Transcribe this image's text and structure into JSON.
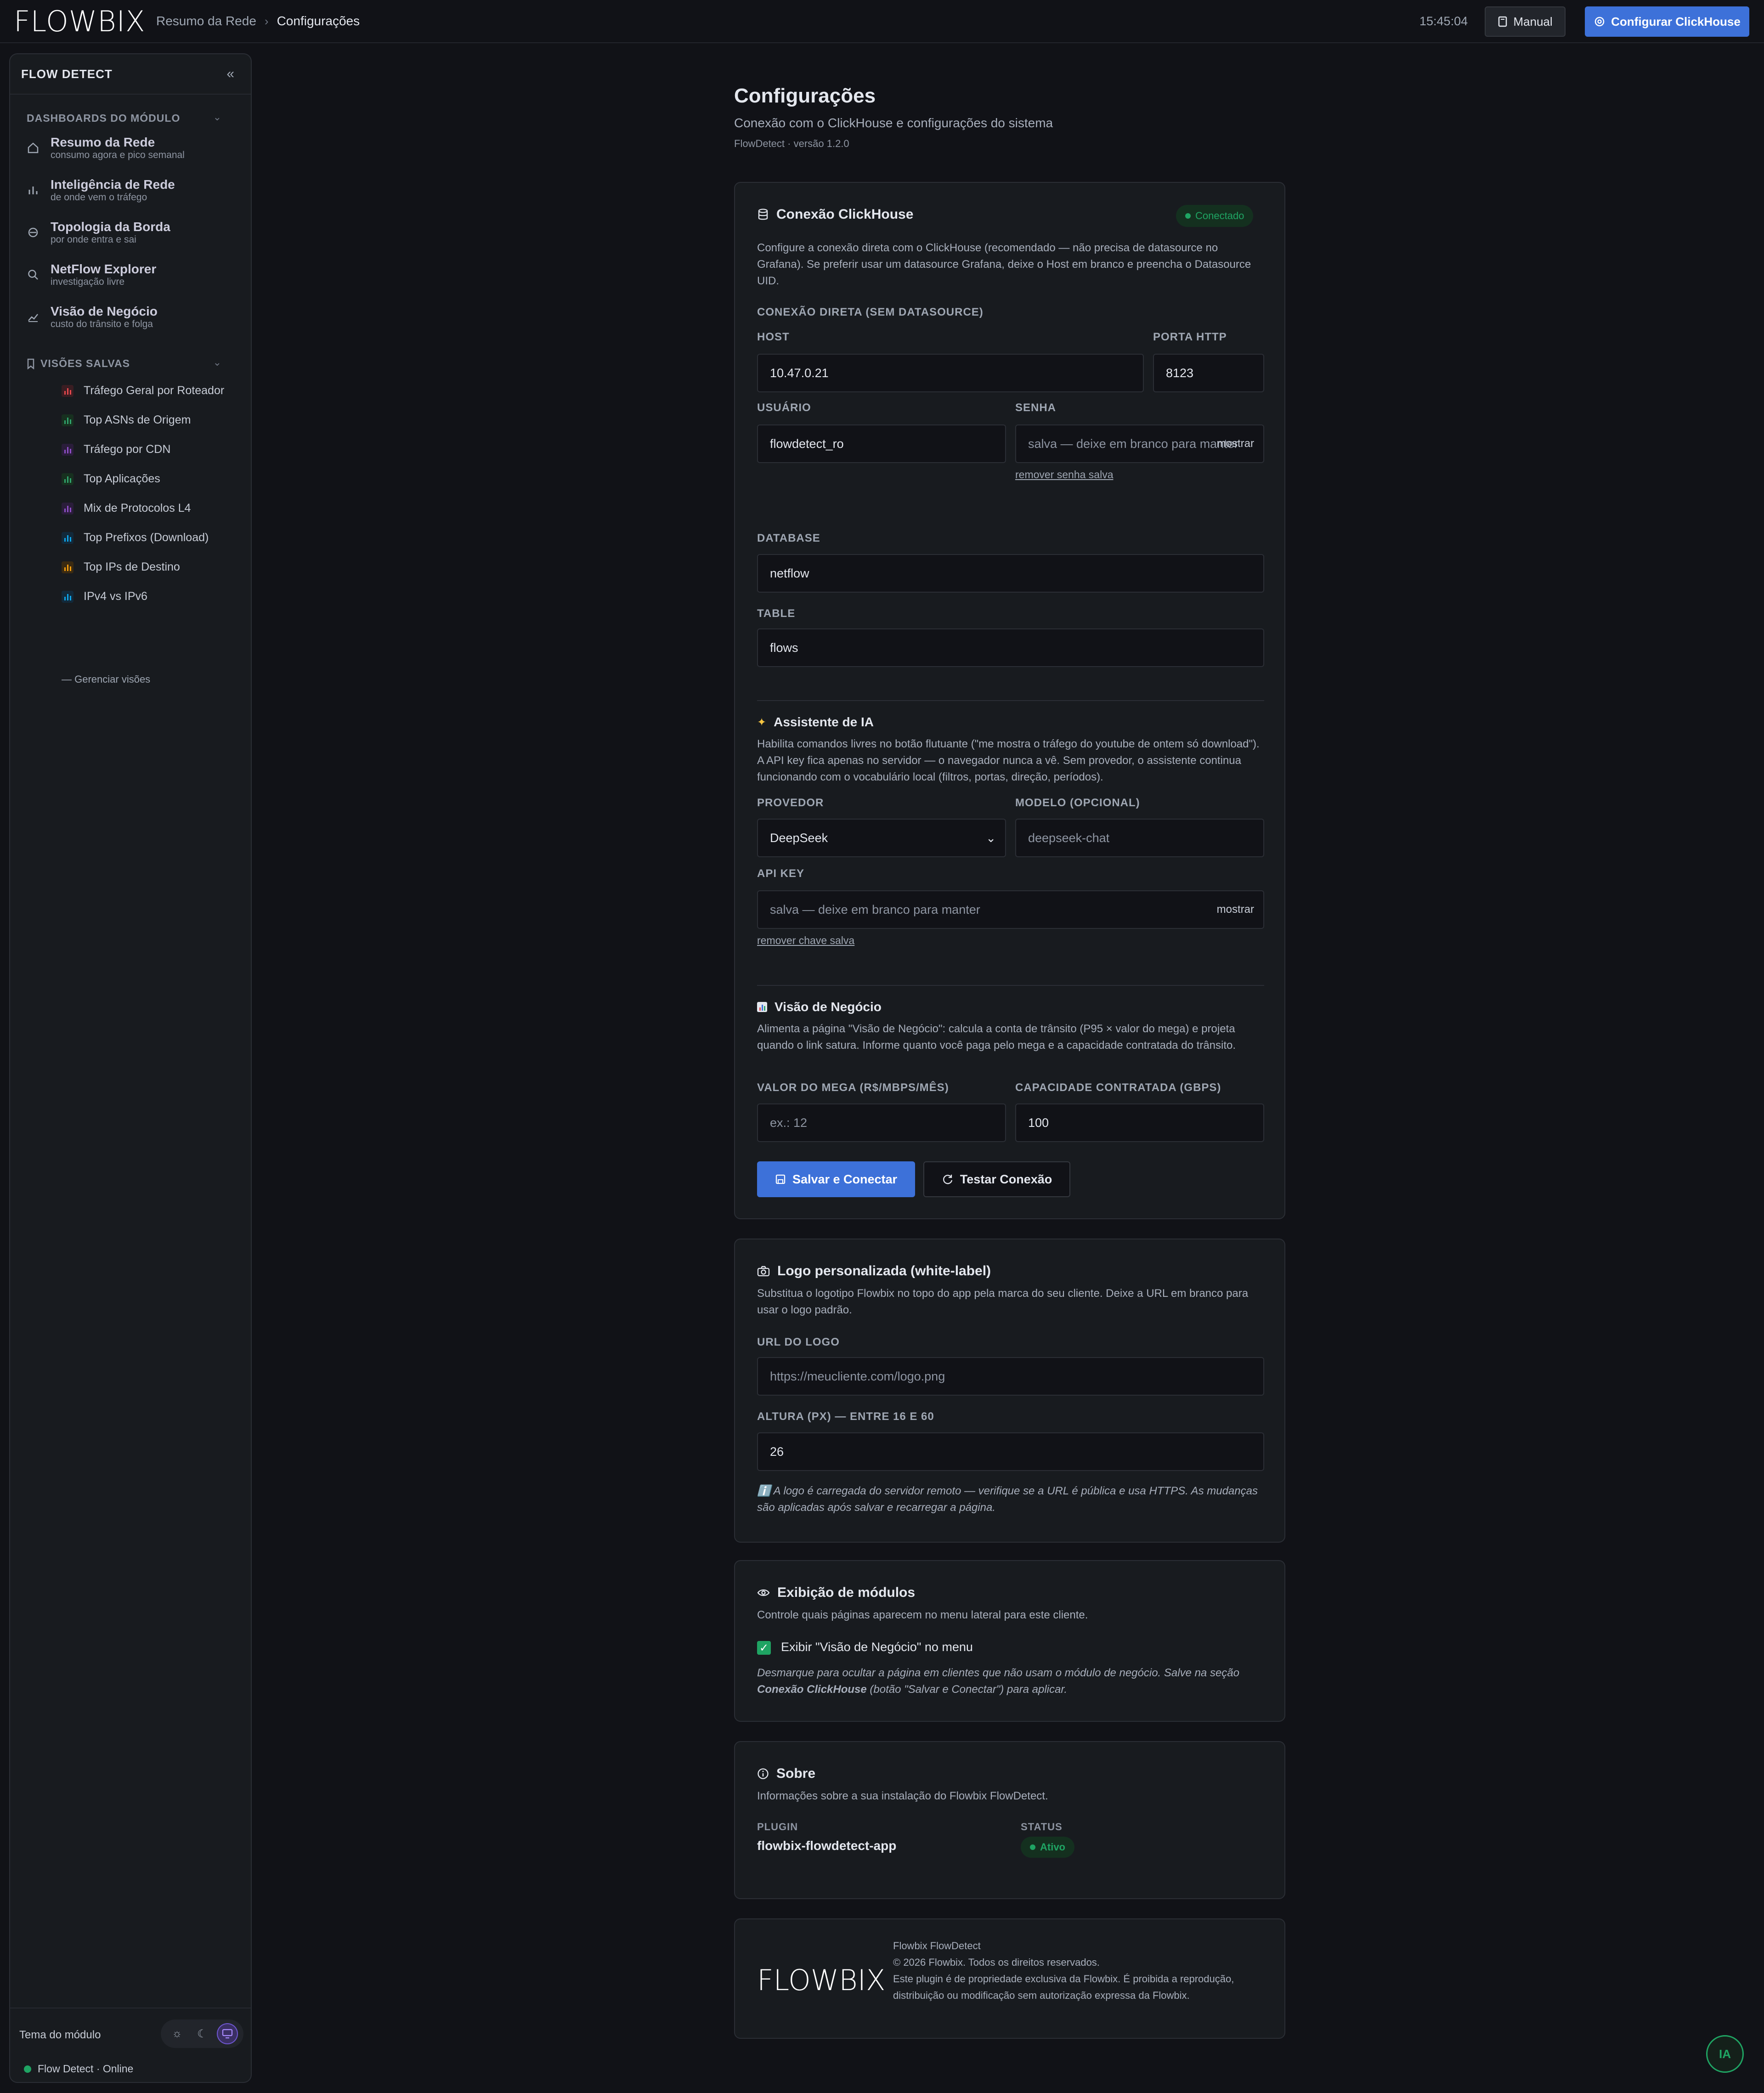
{
  "brand": {
    "logo_text": "FLOWBIX"
  },
  "topbar": {
    "breadcrumb_parent": "Resumo da Rede",
    "breadcrumb_sep": "›",
    "breadcrumb_current": "Configurações",
    "clock": "15:45:04",
    "manual_label": "Manual",
    "config_label": "Configurar ClickHouse"
  },
  "sidebar": {
    "title": "FLOW DETECT",
    "collapse_icon": "«",
    "section_dashboards": "DASHBOARDS DO MÓDULO",
    "nav": [
      {
        "title": "Resumo da Rede",
        "sub": "consumo agora e pico semanal",
        "icon": "home-icon"
      },
      {
        "title": "Inteligência de Rede",
        "sub": "de onde vem o tráfego",
        "icon": "bar-chart-icon"
      },
      {
        "title": "Topologia da Borda",
        "sub": "por onde entra e sai",
        "icon": "topology-icon"
      },
      {
        "title": "NetFlow Explorer",
        "sub": "investigação livre",
        "icon": "search-icon"
      },
      {
        "title": "Visão de Negócio",
        "sub": "custo do trânsito e folga",
        "icon": "trend-icon"
      }
    ],
    "section_saved": "VISÕES SALVAS",
    "saved": [
      {
        "label": "Tráfego Geral por Roteador",
        "color": "#e5484d"
      },
      {
        "label": "Top ASNs de Origem",
        "color": "#30a46c"
      },
      {
        "label": "Tráfego por CDN",
        "color": "#8e4ec6"
      },
      {
        "label": "Top Aplicações",
        "color": "#30a46c"
      },
      {
        "label": "Mix de Protocolos L4",
        "color": "#8e4ec6"
      },
      {
        "label": "Top Prefixos (Download)",
        "color": "#0ea5e9"
      },
      {
        "label": "Top IPs de Destino",
        "color": "#f59e0b"
      },
      {
        "label": "IPv4 vs IPv6",
        "color": "#0ea5e9"
      }
    ],
    "manage_label": "— Gerenciar visões",
    "theme_label": "Tema do módulo",
    "status_label": "Flow Detect · Online"
  },
  "page": {
    "title": "Configurações",
    "subtitle": "Conexão com o ClickHouse e configurações do sistema",
    "version": "FlowDetect · versão 1.2.0"
  },
  "clickhouse": {
    "title": "Conexão ClickHouse",
    "status": "Conectado",
    "description": "Configure a conexão direta com o ClickHouse (recomendado — não precisa de datasource no Grafana). Se preferir usar um datasource Grafana, deixe o Host em branco e preencha o Datasource UID.",
    "direct_label": "CONEXÃO DIRETA (SEM DATASOURCE)",
    "host_label": "HOST",
    "host_value": "10.47.0.21",
    "port_label": "PORTA HTTP",
    "port_value": "8123",
    "user_label": "USUÁRIO",
    "user_value": "flowdetect_ro",
    "password_label": "SENHA",
    "password_placeholder": "salva — deixe em branco para manter",
    "show_label": "mostrar",
    "remove_password": "remover senha salva",
    "database_label": "DATABASE",
    "database_value": "netflow",
    "table_label": "TABLE",
    "table_value": "flows"
  },
  "ai": {
    "title": "Assistente de IA",
    "icon": "sparkles-icon",
    "description": "Habilita comandos livres no botão flutuante (\"me mostra o tráfego do youtube de ontem só download\"). A API key fica apenas no servidor — o navegador nunca a vê. Sem provedor, o assistente continua funcionando com o vocabulário local (filtros, portas, direção, períodos).",
    "provider_label": "PROVEDOR",
    "provider_value": "DeepSeek",
    "model_label": "MODELO (OPCIONAL)",
    "model_placeholder": "deepseek-chat",
    "apikey_label": "API KEY",
    "apikey_placeholder": "salva — deixe em branco para manter",
    "show_label": "mostrar",
    "remove_key": "remover chave salva"
  },
  "business": {
    "title": "Visão de Negócio",
    "icon": "chart-emoji-icon",
    "description": "Alimenta a página \"Visão de Negócio\": calcula a conta de trânsito (P95 × valor do mega) e projeta quando o link satura. Informe quanto você paga pelo mega e a capacidade contratada do trânsito.",
    "mega_label": "VALOR DO MEGA (R$/MBPS/MÊS)",
    "mega_placeholder": "ex.: 12",
    "capacity_label": "CAPACIDADE CONTRATADA (GBPS)",
    "capacity_value": "100",
    "save_label": "Salvar e Conectar",
    "test_label": "Testar Conexão"
  },
  "logo": {
    "title": "Logo personalizada (white-label)",
    "description": "Substitua o logotipo Flowbix no topo do app pela marca do seu cliente. Deixe a URL em branco para usar o logo padrão.",
    "url_label": "URL DO LOGO",
    "url_placeholder": "https://meucliente.com/logo.png",
    "height_label": "ALTURA (PX) — ENTRE 16 E 60",
    "height_value": "26",
    "note": "ℹ️ A logo é carregada do servidor remoto — verifique se a URL é pública e usa HTTPS. As mudanças são aplicadas após salvar e recarregar a página."
  },
  "modules": {
    "title": "Exibição de módulos",
    "description": "Controle quais páginas aparecem no menu lateral para este cliente.",
    "checkbox_label": "Exibir \"Visão de Negócio\" no menu",
    "note_a": "Desmarque para ocultar a página em clientes que não usam o módulo de negócio. Salve na seção ",
    "note_b": "Conexão ClickHouse",
    "note_c": " (botão \"Salvar e Conectar\") para aplicar."
  },
  "about": {
    "title": "Sobre",
    "description": "Informações sobre a sua instalação do Flowbix FlowDetect.",
    "plugin_label": "PLUGIN",
    "plugin_value": "flowbix-flowdetect-app",
    "status_label": "STATUS",
    "status_value": "Ativo"
  },
  "footer": {
    "logo_text": "FLOWBIX",
    "line1": "Flowbix FlowDetect",
    "line2": "© 2026 Flowbix. Todos os direitos reservados.",
    "line3": "Este plugin é de propriedade exclusiva da Flowbix. É proibida a reprodução,",
    "line4": "distribuição ou modificação sem autorização expressa da Flowbix."
  },
  "ia_button": "IA"
}
